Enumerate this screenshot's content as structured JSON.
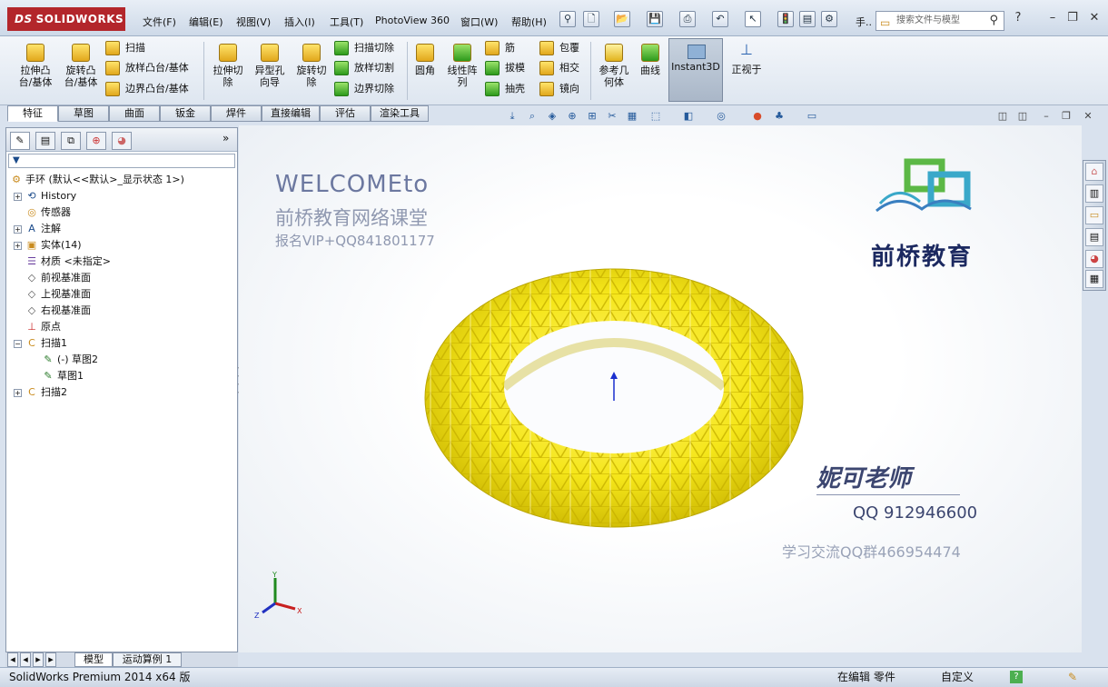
{
  "app": {
    "logo_text": "SOLIDWORKS",
    "logo_mark": "DS"
  },
  "menu": [
    "文件(F)",
    "编辑(E)",
    "视图(V)",
    "插入(I)",
    "工具(T)",
    "PhotoView 360",
    "窗口(W)",
    "帮助(H)"
  ],
  "quick_toolbar_extra": "手..",
  "search": {
    "placeholder": "搜索文件与模型"
  },
  "command_manager": {
    "big_buttons": [
      {
        "label": "拉伸凸\n台/基体"
      },
      {
        "label": "旋转凸\n台/基体"
      },
      {
        "label": "拉伸切\n除"
      },
      {
        "label": "异型孔\n向导"
      },
      {
        "label": "旋转切\n除"
      },
      {
        "label": "圆角"
      },
      {
        "label": "线性阵\n列"
      },
      {
        "label": "参考几\n何体"
      },
      {
        "label": "曲线"
      }
    ],
    "small_buttons_col1": [
      "扫描",
      "放样凸台/基体",
      "边界凸台/基体"
    ],
    "small_buttons_col2": [
      "扫描切除",
      "放样切割",
      "边界切除"
    ],
    "small_buttons_col3": [
      "筋",
      "拔模",
      "抽壳"
    ],
    "small_buttons_col4": [
      "包覆",
      "相交",
      "镜向"
    ],
    "instant3d": "Instant3D",
    "normal_to": "正视于"
  },
  "tabs": [
    "特征",
    "草图",
    "曲面",
    "钣金",
    "焊件",
    "直接编辑",
    "评估",
    "渲染工具"
  ],
  "feature_tree": {
    "filter_icon": "filter-icon",
    "root": "手环  (默认<<默认>_显示状态 1>)",
    "items": [
      {
        "label": "History",
        "indent": 1,
        "expand": "+",
        "icon": "history-icon"
      },
      {
        "label": "传感器",
        "indent": 1,
        "expand": "",
        "icon": "sensor-icon"
      },
      {
        "label": "注解",
        "indent": 1,
        "expand": "+",
        "icon": "annotation-icon"
      },
      {
        "label": "实体(14)",
        "indent": 1,
        "expand": "+",
        "icon": "solid-bodies-icon"
      },
      {
        "label": "材质 <未指定>",
        "indent": 1,
        "expand": "",
        "icon": "material-icon"
      },
      {
        "label": "前视基准面",
        "indent": 1,
        "expand": "",
        "icon": "plane-icon"
      },
      {
        "label": "上视基准面",
        "indent": 1,
        "expand": "",
        "icon": "plane-icon"
      },
      {
        "label": "右视基准面",
        "indent": 1,
        "expand": "",
        "icon": "plane-icon"
      },
      {
        "label": "原点",
        "indent": 1,
        "expand": "",
        "icon": "origin-icon"
      },
      {
        "label": "扫描1",
        "indent": 1,
        "expand": "−",
        "icon": "sweep-icon"
      },
      {
        "label": "(-) 草图2",
        "indent": 2,
        "expand": "",
        "icon": "sketch-icon"
      },
      {
        "label": "草图1",
        "indent": 2,
        "expand": "",
        "icon": "sketch-icon"
      },
      {
        "label": "扫描2",
        "indent": 1,
        "expand": "+",
        "icon": "sweep-icon"
      }
    ]
  },
  "watermark": {
    "welcome": "WELCOMEto",
    "line2": "前桥教育网络课堂",
    "line3": "报名VIP+QQ841801177",
    "brand": "前桥教育",
    "teacher": "妮可老师",
    "qq": "QQ 912946600",
    "group": "学习交流QQ群466954474"
  },
  "triad": {
    "x": "X",
    "y": "Y",
    "z": "Z"
  },
  "bottom_tabs": [
    "模型",
    "运动算例 1"
  ],
  "status": {
    "product": "SolidWorks Premium 2014 x64 版",
    "mode": "在编辑 零件",
    "custom": "自定义"
  },
  "colors": {
    "torus": "#f5e61a",
    "logo_red": "#b3262b",
    "brand_teal": "#3aa8c9",
    "brand_green": "#5cb846"
  }
}
